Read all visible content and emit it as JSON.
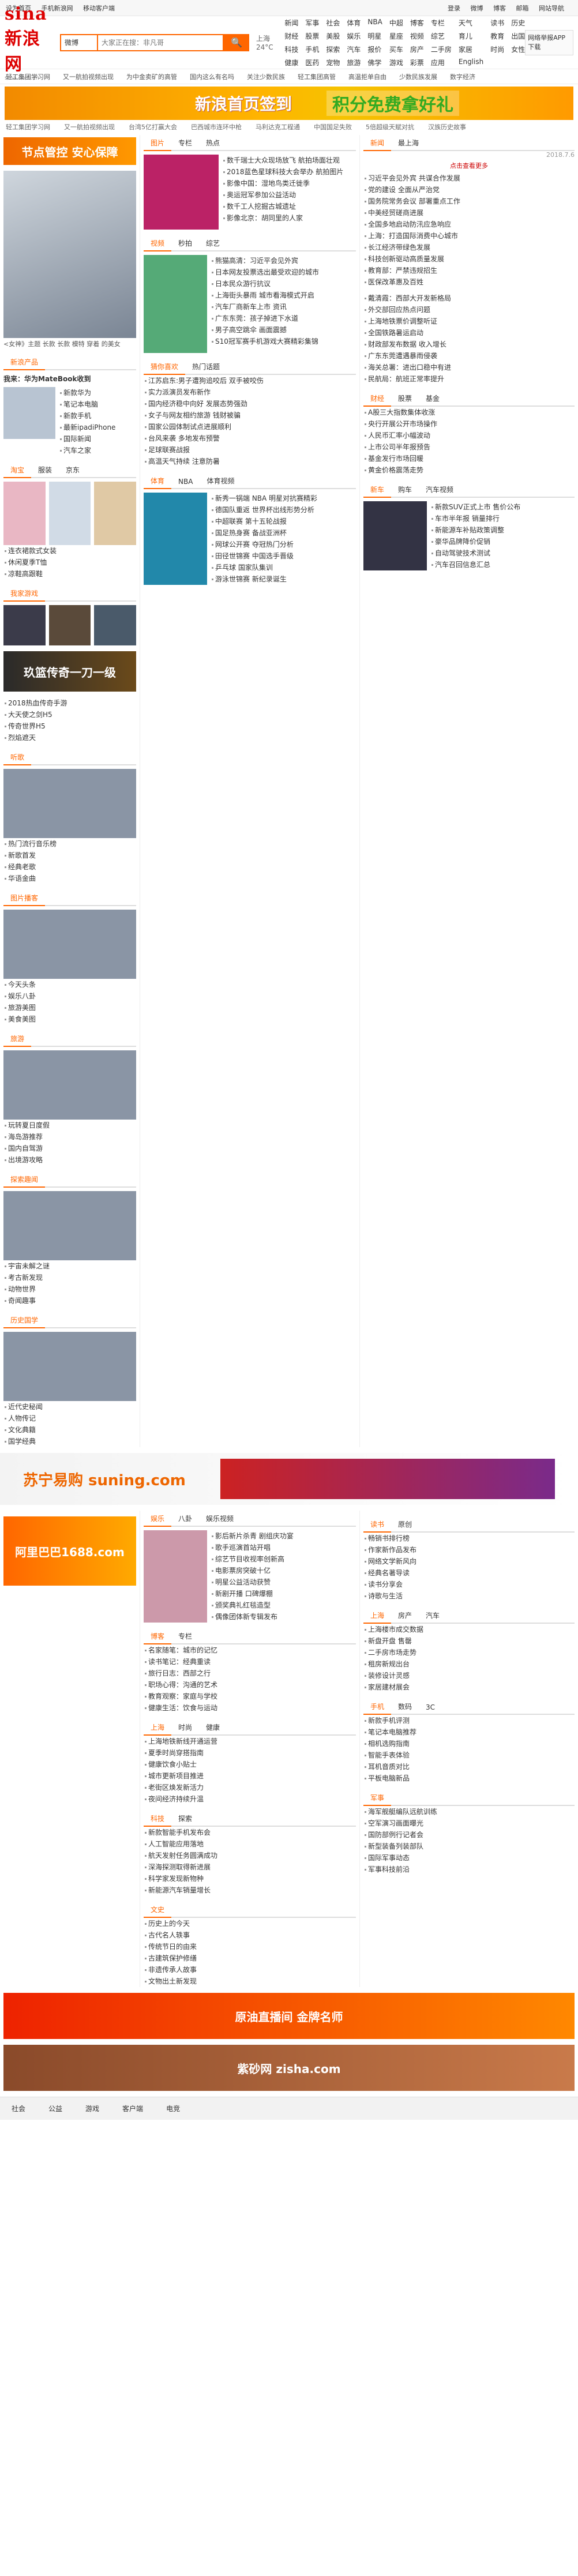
{
  "topbar": {
    "left": [
      "设为首页",
      "手机新浪网",
      "移动客户端"
    ],
    "right": [
      "登录",
      "微博",
      "博客",
      "邮箱",
      "网站导航"
    ]
  },
  "header": {
    "brand": "sina新浪网",
    "url": "sina.com.cn",
    "search_select": "微博",
    "search_placeholder": "大家正在搜：非凡哥",
    "search_button": "🔍",
    "weather": "上海 24°C",
    "nav": [
      "新闻",
      "军事",
      "社会",
      "体育",
      "NBA",
      "中超",
      "博客",
      "专栏",
      "天气",
      "读书",
      "历史",
      "财经",
      "股票",
      "美股",
      "娱乐",
      "明星",
      "星座",
      "视频",
      "综艺",
      "育儿",
      "教育",
      "出国",
      "科技",
      "手机",
      "探索",
      "汽车",
      "报价",
      "买车",
      "房产",
      "二手房",
      "家居",
      "时尚",
      "女性",
      "健康",
      "医药",
      "宠物",
      "旅游",
      "佛学",
      "游戏",
      "彩票",
      "应用",
      "English"
    ],
    "mail_label": "网络举报APP下载"
  },
  "link_row": [
    "轻工集团学习网",
    "又一航拍视频出现",
    "为中金卖矿的高管",
    "国内这么有名吗",
    "关注少数民族",
    "轻工集团高管",
    "高温拒单自由",
    "少数民族发展",
    "数字经济"
  ],
  "banner": {
    "title": "新浪首页签到",
    "promo": "积分免费拿好礼"
  },
  "sub_links": [
    "轻工集团学习网",
    "又一航拍视频出现",
    "台湾5亿打赢大会",
    "巴西城市连环中枪",
    "马利达克工程通",
    "中国国足失败",
    "5倍超级天赋对抗",
    "汉族历史故事"
  ],
  "left": {
    "promo": "节点管控 安心保障",
    "photo_caption": "<女神》主题 长款 长款 模特 穿着 的美女",
    "products": {
      "tabs": [
        "新浪产品"
      ],
      "title": "我来：华为MateBook收到",
      "items": [
        "新款华为",
        "笔记本电脑",
        "新款手机",
        "最新ipadiPhone",
        "国际新闻",
        "汽车之家"
      ]
    },
    "shop_tabs": [
      "淘宝",
      "服装",
      "京东"
    ],
    "shop_items": [
      "连衣裙款式女装",
      "休闲夏季T恤",
      "凉鞋高跟鞋"
    ],
    "game_tabs": [
      "我家游戏"
    ],
    "game_banner": "玖篮传奇一刀一级",
    "game_list": [
      "2018热血传奇手游",
      "大天使之剑H5",
      "传奇世界H5",
      "烈焰遮天"
    ],
    "sections": [
      {
        "title": "听歌",
        "items": [
          "热门流行音乐榜",
          "新歌首发",
          "经典老歌",
          "华语金曲"
        ]
      },
      {
        "title": "图片播客",
        "items": [
          "今天头条",
          "娱乐八卦",
          "旅游美图",
          "美食美图"
        ]
      },
      {
        "title": "旅游",
        "items": [
          "玩转夏日度假",
          "海岛游推荐",
          "国内自驾游",
          "出境游攻略"
        ]
      },
      {
        "title": "探索趣闻",
        "items": [
          "宇宙未解之谜",
          "考古新发现",
          "动物世界",
          "奇闻趣事"
        ]
      },
      {
        "title": "历史国学",
        "items": [
          "近代史秘闻",
          "人物传记",
          "文化典籍",
          "国学经典"
        ]
      }
    ],
    "ad1": "阿里巴巴1688.com",
    "ad2": "原油直播间 金牌名师",
    "ad3": "紫砂网 zisha.com"
  },
  "middle": {
    "tabs1": [
      "图片",
      "专栏",
      "热点"
    ],
    "news1": [
      "数千瑞士大众现场放飞 航拍场面壮观",
      "2018蓝色星球科技大会举办 航拍图片",
      "影像中国：湿地鸟类迁徙季",
      "奥运冠军参加公益活动",
      "数千工人挖掘古城遗址",
      "影像北京：胡同里的人家"
    ],
    "video_tabs": [
      "视频",
      "秒拍",
      "综艺"
    ],
    "video_news": [
      "熊猫高清：习近平会见外宾",
      "日本网友投票选出最受欢迎的城市",
      "日本民众游行抗议",
      "上海街头暴雨 城市看海模式开启",
      "汽车厂商新车上市 资讯",
      "广东东莞：孩子掉进下水道",
      "男子高空跳伞 画面震撼",
      "S10冠军赛手机游戏大赛精彩集锦"
    ],
    "hot_tabs": [
      "猜你喜欢",
      "热门话题"
    ],
    "hot_news": [
      "江苏启东:男子遭狗追咬后 双手被咬伤",
      "实力派演员发布新作",
      "国内经济稳中向好 发展态势强劲",
      "女子与网友相约旅游 钱财被骗",
      "国家公园体制试点进展顺利",
      "台风来袭 多地发布预警",
      "足球联赛战报",
      "高温天气持续 注意防暑"
    ],
    "sports_tabs": [
      "体育",
      "NBA",
      "体育视频"
    ],
    "sports_news": [
      "新秀一锅端 NBA 明星对抗赛精彩",
      "德国队重返 世界杯出线形势分析",
      "中超联赛 第十五轮战报",
      "国足热身赛 备战亚洲杯",
      "网球公开赛 夺冠热门分析",
      "田径世锦赛 中国选手晋级",
      "乒乓球 国家队集训",
      "游泳世锦赛 新纪录诞生"
    ],
    "ad_suning": "苏宁易购 suning.com",
    "ent_tabs": [
      "娱乐",
      "八卦",
      "娱乐视频"
    ],
    "ent_news": [
      "影后新片杀青 剧组庆功宴",
      "歌手巡演首站开唱",
      "综艺节目收视率创新高",
      "电影票房突破十亿",
      "明星公益活动获赞",
      "新剧开播 口碑爆棚",
      "颁奖典礼红毯造型",
      "偶像团体新专辑发布"
    ],
    "blog_tabs": [
      "博客",
      "专栏"
    ],
    "blog_news": [
      "名家随笔：城市的记忆",
      "读书笔记：经典重读",
      "旅行日志：西部之行",
      "职场心得：沟通的艺术",
      "教育观察：家庭与学校",
      "健康生活：饮食与运动"
    ],
    "sh_tabs": [
      "上海",
      "时尚",
      "健康"
    ],
    "sh_news": [
      "上海地铁新线开通运营",
      "夏季时尚穿搭指南",
      "健康饮食小贴士",
      "城市更新项目推进",
      "老街区焕发新活力",
      "夜间经济持续升温"
    ],
    "tech_tabs": [
      "科技",
      "探索"
    ],
    "tech_news": [
      "新款智能手机发布会",
      "人工智能应用落地",
      "航天发射任务圆满成功",
      "深海探测取得新进展",
      "科学家发现新物种",
      "新能源汽车销量增长"
    ],
    "culture_tabs": [
      "文史"
    ],
    "culture_news": [
      "历史上的今天",
      "古代名人轶事",
      "传统节日的由来",
      "古建筑保护修缮",
      "非遗传承人故事",
      "文物出土新发现"
    ]
  },
  "right": {
    "tabs1": [
      "新闻",
      "最上海"
    ],
    "date": "2018.7.6",
    "top_news": "点击查看更多",
    "news1": [
      "习近平会见外宾 共谋合作发展",
      "党的建设 全面从严治党",
      "国务院常务会议 部署重点工作",
      "中美经贸磋商进展",
      "全国多地启动防汛应急响应",
      "上海：打造国际消费中心城市",
      "长江经济带绿色发展",
      "科技创新驱动高质量发展",
      "教育部：严禁违规招生",
      "医保改革惠及百姓"
    ],
    "news2": [
      "戴清霞：西部大开发新格局",
      "外交部回应热点问题",
      "上海地铁票价调整听证",
      "全国铁路暑运启动",
      "财政部发布数据 收入增长",
      "广东东莞遭遇暴雨侵袭",
      "海关总署：进出口稳中有进",
      "民航局：航班正常率提升"
    ],
    "finance_tabs": [
      "财经",
      "股票",
      "基金"
    ],
    "finance_news": [
      "A股三大指数集体收涨",
      "央行开展公开市场操作",
      "人民币汇率小幅波动",
      "上市公司半年报预告",
      "基金发行市场回暖",
      "黄金价格震荡走势"
    ],
    "auto_tabs": [
      "新车",
      "购车",
      "汽车视频"
    ],
    "auto_news": [
      "新款SUV正式上市 售价公布",
      "车市半年报 销量排行",
      "新能源车补贴政策调整",
      "豪华品牌降价促销",
      "自动驾驶技术测试",
      "汽车召回信息汇总"
    ],
    "read_tabs": [
      "读书",
      "原创"
    ],
    "read_news": [
      "畅销书排行榜",
      "作家新作品发布",
      "网络文学新风向",
      "经典名著导读",
      "读书分享会",
      "诗歌与生活"
    ],
    "health_tabs": [
      "上海",
      "房产",
      "汽车"
    ],
    "health_news": [
      "上海楼市成交数据",
      "新盘开盘 售罄",
      "二手房市场走势",
      "租房新规出台",
      "装修设计灵感",
      "家居建材展会"
    ],
    "mobile_tabs": [
      "手机",
      "数码",
      "3C"
    ],
    "mobile_news": [
      "新款手机评测",
      "笔记本电脑推荐",
      "相机选购指南",
      "智能手表体验",
      "耳机音质对比",
      "平板电脑新品"
    ],
    "mil_tabs": [
      "军事"
    ],
    "mil_news": [
      "海军舰艇编队远航训练",
      "空军演习画面曝光",
      "国防部例行记者会",
      "新型装备列装部队",
      "国际军事动态",
      "军事科技前沿"
    ]
  },
  "footer": [
    "社会",
    "公益",
    "游戏",
    "客户端",
    "电竞"
  ]
}
